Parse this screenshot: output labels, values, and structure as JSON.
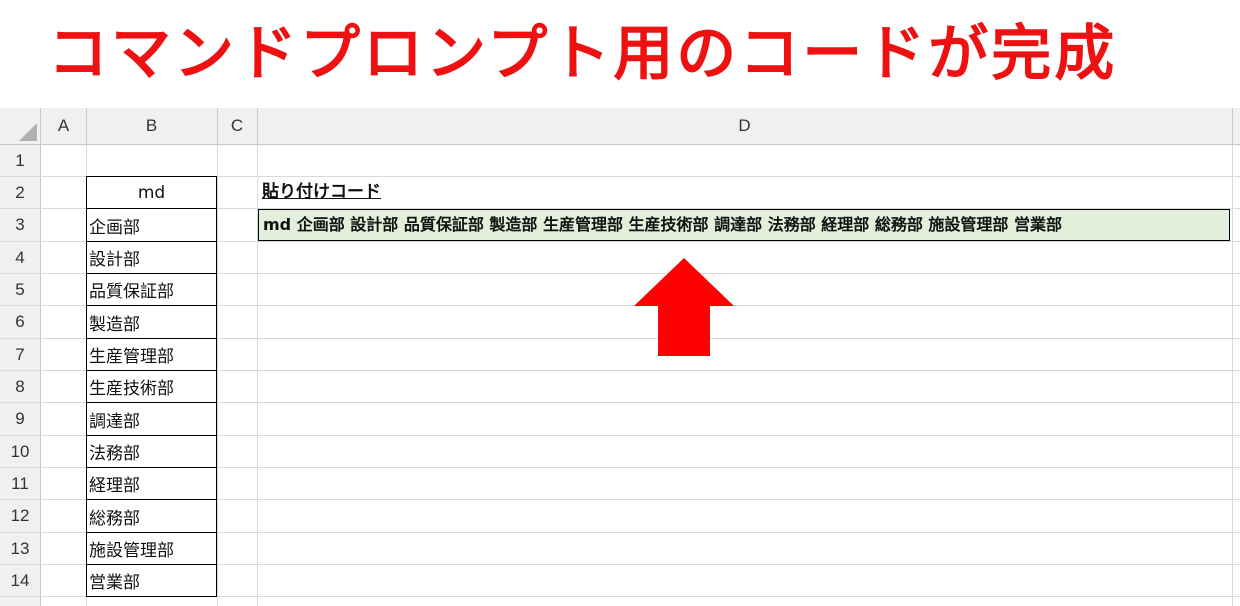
{
  "headline": "コマンドプロンプト用のコードが完成",
  "columns": [
    "A",
    "B",
    "C",
    "D"
  ],
  "rows": [
    "1",
    "2",
    "3",
    "4",
    "5",
    "6",
    "7",
    "8",
    "9",
    "10",
    "11",
    "12",
    "13",
    "14"
  ],
  "column_b": [
    "md",
    "企画部",
    "設計部",
    "品質保証部",
    "製造部",
    "生産管理部",
    "生産技術部",
    "調達部",
    "法務部",
    "経理部",
    "総務部",
    "施設管理部",
    "営業部"
  ],
  "column_d": {
    "label": "貼り付けコード",
    "code": "md 企画部 設計部 品質保証部 製造部 生産管理部 生産技術部 調達部 法務部 経理部 総務部 施設管理部 営業部"
  },
  "colors": {
    "headline": "#ee1111",
    "arrow": "#ff0000",
    "code_fill": "#e2efda"
  },
  "icons": {
    "arrow": "up-arrow-icon",
    "select_all": "select-all-triangle-icon"
  }
}
